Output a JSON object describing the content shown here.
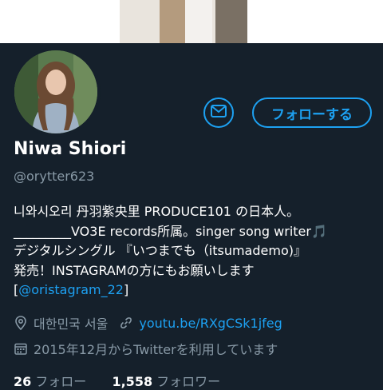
{
  "profile": {
    "name": "Niwa Shiori",
    "handle": "@orytter623",
    "follow_label": "フォローする",
    "bio": {
      "line1": "니와시오리 丹羽紫央里 PRODUCE101 の日本人。",
      "line2_prefix": "_________VO3E records所属。singer song writer",
      "line2_emoji": "🎵",
      "line3": "デジタルシングル 『いつまでも（itsumademo)』",
      "line4": "発売！INSTAGRAMの方にもお願いします",
      "line5_open": "[",
      "line5_link": "@oristagram_22",
      "line5_close": "]"
    },
    "location": "대한민국 서울",
    "website": "youtu.be/RXgCSk1jfeg",
    "joined": "2015年12月からTwitterを利用しています",
    "following_count": "26",
    "following_label": "フォロー",
    "followers_count": "1,558",
    "followers_label": "フォロワー"
  },
  "icons": {
    "message": "envelope-icon",
    "location": "location-pin-icon",
    "link": "link-icon",
    "calendar": "calendar-icon"
  },
  "colors": {
    "background": "#15202b",
    "accent": "#1da1f2",
    "secondary_text": "#8899a6",
    "primary_text": "#ffffff"
  }
}
